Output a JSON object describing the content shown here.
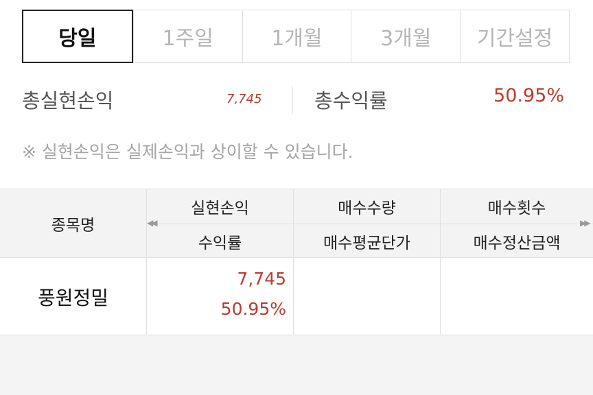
{
  "tabs": [
    {
      "label": "당일",
      "active": true
    },
    {
      "label": "1주일",
      "active": false
    },
    {
      "label": "1개월",
      "active": false
    },
    {
      "label": "3개월",
      "active": false
    },
    {
      "label": "기간설정",
      "active": false
    }
  ],
  "summary": {
    "realized_label": "총실현손익",
    "realized_value": "7,745",
    "return_label": "총수익률",
    "return_value": "50.95%"
  },
  "notice": "※ 실현손익은 실제손익과 상이할 수 있습니다.",
  "table": {
    "header": {
      "name": "종목명",
      "col1_top": "실현손익",
      "col1_bottom": "수익률",
      "col2_top": "매수수량",
      "col2_bottom": "매수평균단가",
      "col3_top": "매수횟수",
      "col3_bottom": "매수정산금액"
    },
    "rows": [
      {
        "name": "풍원정밀",
        "realized": "7,745",
        "return_rate": "50.95%",
        "buy_qty": "",
        "buy_avg_price": "",
        "buy_count": "",
        "buy_settle_amount": ""
      }
    ]
  },
  "colors": {
    "profit": "#c0392b",
    "header_bg": "#f3f3f3",
    "border": "#e0e0e0"
  }
}
